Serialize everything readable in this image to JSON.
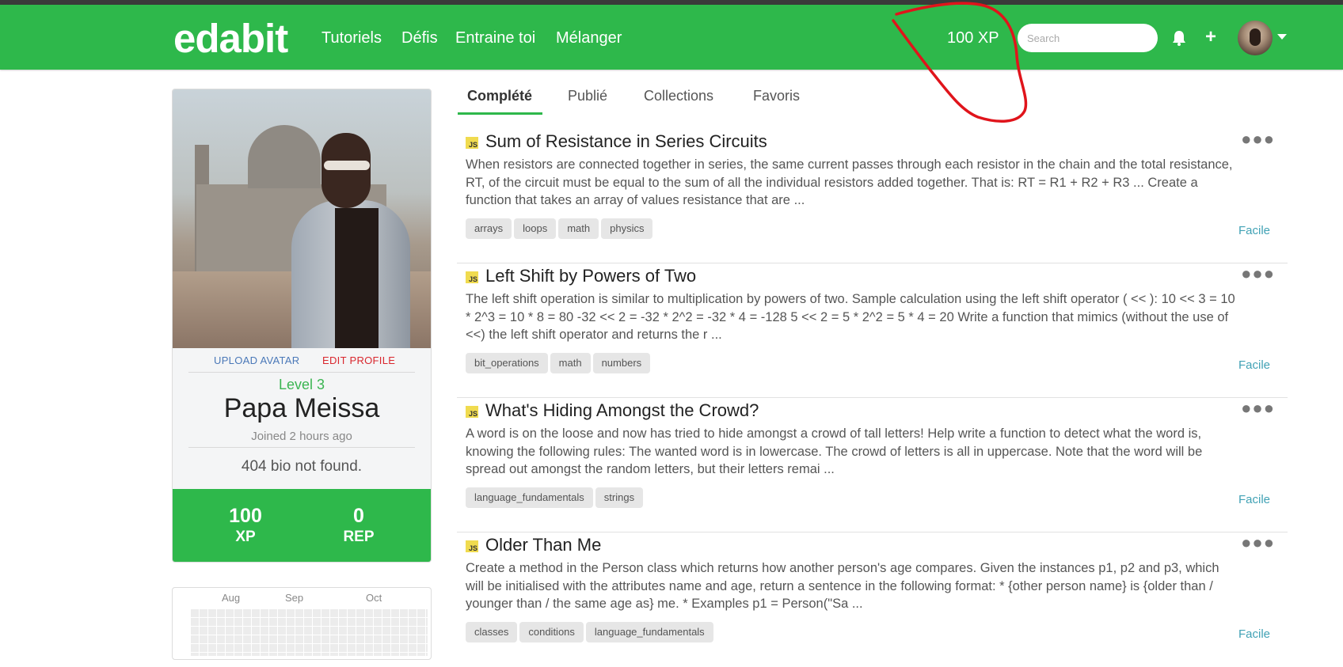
{
  "nav": {
    "logo": "edabit",
    "links": [
      "Tutoriels",
      "Défis",
      "Entraine toi",
      "Mélanger"
    ],
    "xp": "100 XP",
    "search_placeholder": "Search",
    "icons": [
      "bell-icon",
      "plus-icon",
      "avatar",
      "chevron-down-icon"
    ]
  },
  "profile": {
    "upload_avatar": "UPLOAD AVATAR",
    "edit_profile": "EDIT PROFILE",
    "level": "Level 3",
    "name": "Papa Meissa",
    "joined": "Joined 2 hours ago",
    "bio": "404 bio not found.",
    "stats": [
      {
        "value": "100",
        "label": "XP"
      },
      {
        "value": "0",
        "label": "REP"
      }
    ]
  },
  "heatmap": {
    "months": [
      "Aug",
      "Sep",
      "Oct"
    ]
  },
  "tabs": [
    {
      "label": "Complété",
      "active": true
    },
    {
      "label": "Publié",
      "active": false
    },
    {
      "label": "Collections",
      "active": false
    },
    {
      "label": "Favoris",
      "active": false
    }
  ],
  "challenges": [
    {
      "lang": "JS",
      "title": "Sum of Resistance in Series Circuits",
      "description": "When resistors are connected together in series, the same current passes through each resistor in the chain and the total resistance, RT, of the circuit must be equal to the sum of all the individual resistors added together. That is: RT = R1 + R2 + R3 ... Create a function that takes an array of values resistance that are ...",
      "tags": [
        "arrays",
        "loops",
        "math",
        "physics"
      ],
      "difficulty": "Facile"
    },
    {
      "lang": "JS",
      "title": "Left Shift by Powers of Two",
      "description": "The left shift operation is similar to multiplication by powers of two. Sample calculation using the left shift operator ( << ): 10 << 3 = 10 * 2^3 = 10 * 8 = 80 -32 << 2 = -32 * 2^2 = -32 * 4 = -128 5 << 2 = 5 * 2^2 = 5 * 4 = 20 Write a function that mimics (without the use of <<) the left shift operator and returns the r ...",
      "tags": [
        "bit_operations",
        "math",
        "numbers"
      ],
      "difficulty": "Facile"
    },
    {
      "lang": "JS",
      "title": "What's Hiding Amongst the Crowd?",
      "description": "A word is on the loose and now has tried to hide amongst a crowd of tall letters! Help write a function to detect what the word is, knowing the following rules: The wanted word is in lowercase. The crowd of letters is all in uppercase. Note that the word will be spread out amongst the random letters, but their letters remai ...",
      "tags": [
        "language_fundamentals",
        "strings"
      ],
      "difficulty": "Facile"
    },
    {
      "lang": "JS",
      "title": "Older Than Me",
      "description": "Create a method in the Person class which returns how another person's age compares. Given the instances p1, p2 and p3, which will be initialised with the attributes name and age, return a sentence in the following format: * {other person name} is {older than / younger than / the same age as} me. * Examples p1 = Person(\"Sa ...",
      "tags": [
        "classes",
        "conditions",
        "language_fundamentals"
      ],
      "difficulty": "Facile"
    }
  ],
  "colors": {
    "brand_green": "#2eb84b",
    "difficulty_teal": "#41a2b5",
    "upload_blue": "#4a78b8",
    "edit_red": "#d9272e",
    "annotation_red": "#e0141b"
  }
}
